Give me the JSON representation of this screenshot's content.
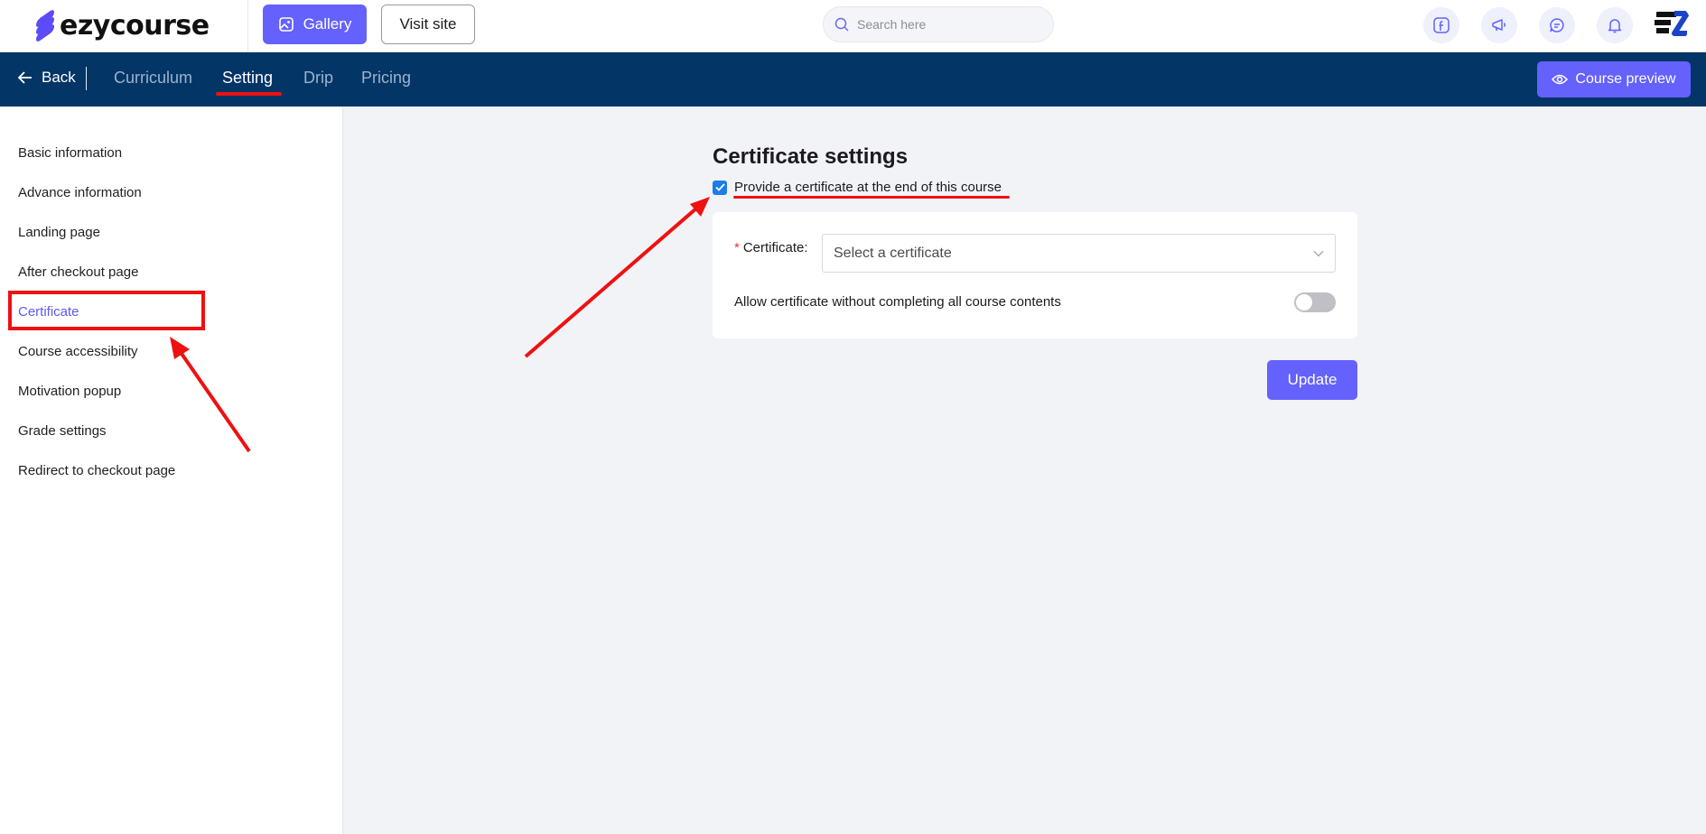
{
  "header": {
    "logo_text": "ezycourse",
    "gallery_label": "Gallery",
    "visit_site_label": "Visit site",
    "search_placeholder": "Search here",
    "icons": [
      "facebook-icon",
      "megaphone-icon",
      "chat-icon",
      "bell-icon"
    ]
  },
  "nav": {
    "back_label": "Back",
    "tabs": [
      {
        "label": "Curriculum",
        "active": false
      },
      {
        "label": "Setting",
        "active": true
      },
      {
        "label": "Drip",
        "active": false
      },
      {
        "label": "Pricing",
        "active": false
      }
    ],
    "preview_label": "Course preview"
  },
  "sidebar": {
    "items": [
      {
        "label": "Basic information",
        "active": false
      },
      {
        "label": "Advance information",
        "active": false
      },
      {
        "label": "Landing page",
        "active": false
      },
      {
        "label": "After checkout page",
        "active": false
      },
      {
        "label": "Certificate",
        "active": true
      },
      {
        "label": "Course accessibility",
        "active": false
      },
      {
        "label": "Motivation popup",
        "active": false
      },
      {
        "label": "Grade settings",
        "active": false
      },
      {
        "label": "Redirect to checkout page",
        "active": false
      }
    ]
  },
  "main": {
    "title": "Certificate settings",
    "provide_checkbox_label": "Provide a certificate at the end of this course",
    "provide_checked": true,
    "certificate_label": "Certificate",
    "certificate_colon": ":",
    "certificate_placeholder": "Select a certificate",
    "allow_without_label": "Allow certificate without completing all course contents",
    "allow_without_enabled": false,
    "update_label": "Update"
  },
  "colors": {
    "accent": "#6461fc",
    "nav_bg": "#033567",
    "annotation": "#ee1111",
    "checkbox": "#1e7ce8"
  }
}
